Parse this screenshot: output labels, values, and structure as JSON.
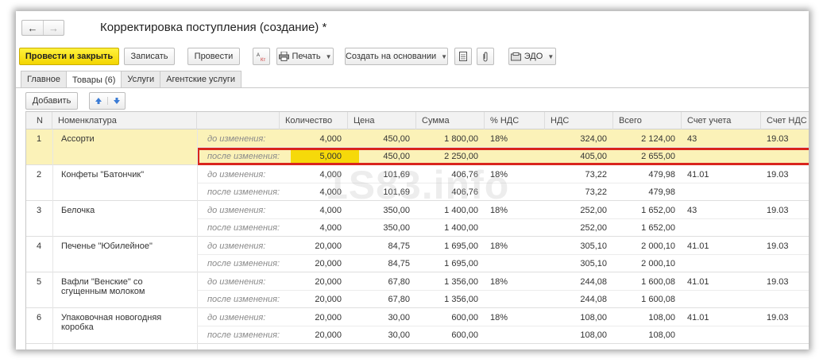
{
  "window": {
    "title": "Корректировка поступления (создание) *",
    "nav_back": "←",
    "nav_forward": "→"
  },
  "toolbar": {
    "post_close": "Провести и закрыть",
    "save": "Записать",
    "post": "Провести",
    "print": "Печать",
    "create_based": "Создать на основании",
    "edo": "ЭДО"
  },
  "tabs": [
    "Главное",
    "Товары (6)",
    "Услуги",
    "Агентские услуги"
  ],
  "subbar": {
    "add": "Добавить"
  },
  "columns": [
    "N",
    "Номенклатура",
    "",
    "Количество",
    "Цена",
    "Сумма",
    "% НДС",
    "НДС",
    "Всего",
    "Счет учета",
    "Счет НДС"
  ],
  "labels": {
    "before": "до изменения:",
    "after": "после изменения:"
  },
  "rows": [
    {
      "n": "1",
      "name": "Ассорти",
      "name2": "",
      "before": {
        "qty": "4,000",
        "price": "450,00",
        "sum": "1 800,00",
        "vat_rate": "18%",
        "vat": "324,00",
        "total": "2 124,00",
        "acc": "43",
        "acc_vat": "19.03"
      },
      "after": {
        "qty": "5,000",
        "price": "450,00",
        "sum": "2 250,00",
        "vat": "405,00",
        "total": "2 655,00"
      }
    },
    {
      "n": "2",
      "name": "Конфеты \"Батончик\"",
      "name2": "",
      "before": {
        "qty": "4,000",
        "price": "101,69",
        "sum": "406,76",
        "vat_rate": "18%",
        "vat": "73,22",
        "total": "479,98",
        "acc": "41.01",
        "acc_vat": "19.03"
      },
      "after": {
        "qty": "4,000",
        "price": "101,69",
        "sum": "406,76",
        "vat": "73,22",
        "total": "479,98"
      }
    },
    {
      "n": "3",
      "name": "Белочка",
      "name2": "",
      "before": {
        "qty": "4,000",
        "price": "350,00",
        "sum": "1 400,00",
        "vat_rate": "18%",
        "vat": "252,00",
        "total": "1 652,00",
        "acc": "43",
        "acc_vat": "19.03"
      },
      "after": {
        "qty": "4,000",
        "price": "350,00",
        "sum": "1 400,00",
        "vat": "252,00",
        "total": "1 652,00"
      }
    },
    {
      "n": "4",
      "name": "Печенье \"Юбилейное\"",
      "name2": "",
      "before": {
        "qty": "20,000",
        "price": "84,75",
        "sum": "1 695,00",
        "vat_rate": "18%",
        "vat": "305,10",
        "total": "2 000,10",
        "acc": "41.01",
        "acc_vat": "19.03"
      },
      "after": {
        "qty": "20,000",
        "price": "84,75",
        "sum": "1 695,00",
        "vat": "305,10",
        "total": "2 000,10"
      }
    },
    {
      "n": "5",
      "name": "Вафли \"Венские\" со",
      "name2": "сгущенным молоком",
      "before": {
        "qty": "20,000",
        "price": "67,80",
        "sum": "1 356,00",
        "vat_rate": "18%",
        "vat": "244,08",
        "total": "1 600,08",
        "acc": "41.01",
        "acc_vat": "19.03"
      },
      "after": {
        "qty": "20,000",
        "price": "67,80",
        "sum": "1 356,00",
        "vat": "244,08",
        "total": "1 600,08"
      }
    },
    {
      "n": "6",
      "name": "Упаковочная новогодняя",
      "name2": "коробка",
      "before": {
        "qty": "20,000",
        "price": "30,00",
        "sum": "600,00",
        "vat_rate": "18%",
        "vat": "108,00",
        "total": "108,00",
        "acc": "41.01",
        "acc_vat": "19.03"
      },
      "after": {
        "qty": "20,000",
        "price": "30,00",
        "sum": "600,00",
        "vat": "108,00",
        "total": "108,00"
      }
    }
  ],
  "watermark": "1S83.info",
  "colors": {
    "primary_button": "#f3d500",
    "selected_row": "#fbf2b8",
    "highlight_border": "#d9251d"
  }
}
